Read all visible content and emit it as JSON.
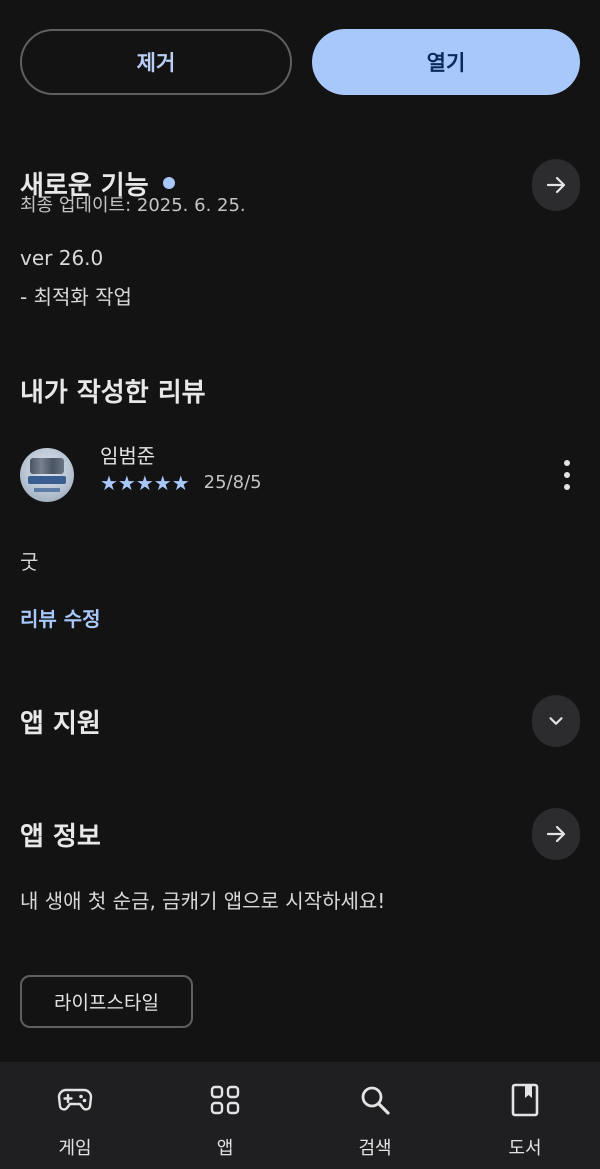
{
  "actions": {
    "uninstall_label": "제거",
    "open_label": "열기"
  },
  "whats_new": {
    "title": "새로운 기능",
    "updated": "최종 업데이트: 2025. 6. 25.",
    "version": "ver 26.0",
    "notes": "- 최적화 작업"
  },
  "my_review": {
    "title": "내가 작성한 리뷰",
    "reviewer": "임범준",
    "rating": 5,
    "stars": "★★★★★",
    "date": "25/8/5",
    "text": "굿",
    "edit_label": "리뷰 수정"
  },
  "app_support": {
    "title": "앱 지원"
  },
  "app_info": {
    "title": "앱 정보",
    "description": "내 생애 첫 순금, 금캐기 앱으로 시작하세요!",
    "category": "라이프스타일"
  },
  "bottom_nav": [
    {
      "label": "게임",
      "icon": "gamepad-icon"
    },
    {
      "label": "앱",
      "icon": "apps-grid-icon"
    },
    {
      "label": "검색",
      "icon": "search-icon"
    },
    {
      "label": "도서",
      "icon": "book-icon"
    }
  ],
  "colors": {
    "background": "#131313",
    "accent": "#a8c7fa",
    "nav_background": "#1f1f21"
  }
}
